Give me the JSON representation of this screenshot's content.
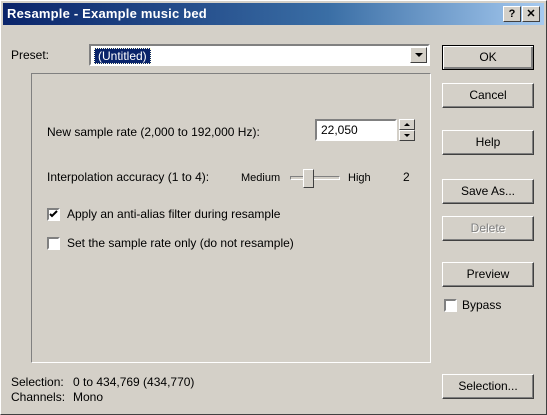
{
  "window": {
    "title": "Resample - Example music bed",
    "help_btn": "?",
    "close_btn": "✕"
  },
  "preset": {
    "label": "Preset:",
    "value": "(Untitled)"
  },
  "settings": {
    "sample_rate_label": "New sample rate (2,000 to 192,000 Hz):",
    "sample_rate_value": "22,050",
    "interp_label": "Interpolation accuracy (1 to 4):",
    "slider_min_label": "Medium",
    "slider_max_label": "High",
    "interp_value": "2",
    "interp_level": 2,
    "interp_min": 1,
    "interp_max": 4,
    "anti_alias_label": "Apply an anti-alias filter during resample",
    "anti_alias_checked": true,
    "rate_only_label": "Set the sample rate only (do not resample)",
    "rate_only_checked": false
  },
  "buttons": {
    "ok": "OK",
    "cancel": "Cancel",
    "help": "Help",
    "save_as": "Save As...",
    "delete": "Delete",
    "preview": "Preview",
    "bypass": "Bypass",
    "selection": "Selection..."
  },
  "status": {
    "selection_label": "Selection:",
    "selection_value": "0 to 434,769 (434,770)",
    "channels_label": "Channels:",
    "channels_value": "Mono"
  }
}
